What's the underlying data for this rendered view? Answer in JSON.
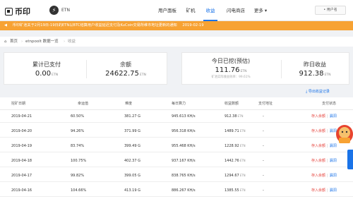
{
  "brand": {
    "name": "币印",
    "coin": "ETN",
    "coin_icon": "lightning-icon"
  },
  "menu": [
    {
      "label": "用户面板"
    },
    {
      "label": "矿机"
    },
    {
      "label": "收益"
    },
    {
      "label": "闪电商店"
    },
    {
      "label": "更多 ▾"
    }
  ],
  "menu_active_index": 2,
  "user": {
    "label": "• 用户名"
  },
  "notice": {
    "text": "币印矿池关于2月19日-19日的ETN以BTC结算用户收益延迟支付及KuCoin交易所维市地址更新的通知",
    "date": "2019-02-19"
  },
  "breadcrumb": {
    "home": "首页",
    "section": "etnpoolt 数据一览",
    "current": "收益"
  },
  "stats": {
    "unpaid": {
      "label": "累计已支付",
      "value": "0.00",
      "unit": "ETN"
    },
    "balance": {
      "label": "余额",
      "value": "24622.75",
      "unit": "ETN"
    },
    "today": {
      "label": "今日已挖(预估)",
      "value": "111.76",
      "unit": "ETN",
      "sub": "矿池实际收益效率：99.61%"
    },
    "yesterday": {
      "label": "昨日收益",
      "value": "912.38",
      "unit": "ETN"
    }
  },
  "export_label": "导出收益记录",
  "table": {
    "headers": [
      "挖矿日期",
      "幸运值",
      "难度",
      "每日算力",
      "收益数额",
      "支付地址",
      "支付状态"
    ],
    "rows": [
      {
        "date": "2019-04-21",
        "luck": "60.50%",
        "diff": "381.27 G",
        "hash": "945.613 KH/s",
        "amount": "912.38",
        "unit": "ETN",
        "addr": "-",
        "a": "存入余额",
        "b": "漏洞"
      },
      {
        "date": "2019-04-20",
        "luck": "94.26%",
        "diff": "371.99 G",
        "hash": "956.318 KH/s",
        "amount": "1489.71",
        "unit": "ETN",
        "addr": "-",
        "a": "存入余额",
        "b": "漏洞"
      },
      {
        "date": "2019-04-19",
        "luck": "83.74%",
        "diff": "399.49 G",
        "hash": "955.468 KH/s",
        "amount": "1228.92",
        "unit": "ETN",
        "addr": "-",
        "a": "存入余额",
        "b": "漏洞"
      },
      {
        "date": "2019-04-18",
        "luck": "100.75%",
        "diff": "402.37 G",
        "hash": "937.167 KH/s",
        "amount": "1442.76",
        "unit": "ETN",
        "addr": "-",
        "a": "存入余额",
        "b": "漏洞"
      },
      {
        "date": "2019-04-17",
        "luck": "99.82%",
        "diff": "399.05 G",
        "hash": "838.765 KH/s",
        "amount": "1294.67",
        "unit": "ETN",
        "addr": "-",
        "a": "存入余额",
        "b": "漏洞"
      },
      {
        "date": "2019-04-16",
        "luck": "104.66%",
        "diff": "413.19 G",
        "hash": "886.267 KH/s",
        "amount": "1385.55",
        "unit": "ETN",
        "addr": "-",
        "a": "存入余额",
        "b": "漏洞"
      }
    ]
  },
  "colors": {
    "accent": "#1a73e8",
    "notice": "#f7a233",
    "action_red": "#e6433c"
  }
}
